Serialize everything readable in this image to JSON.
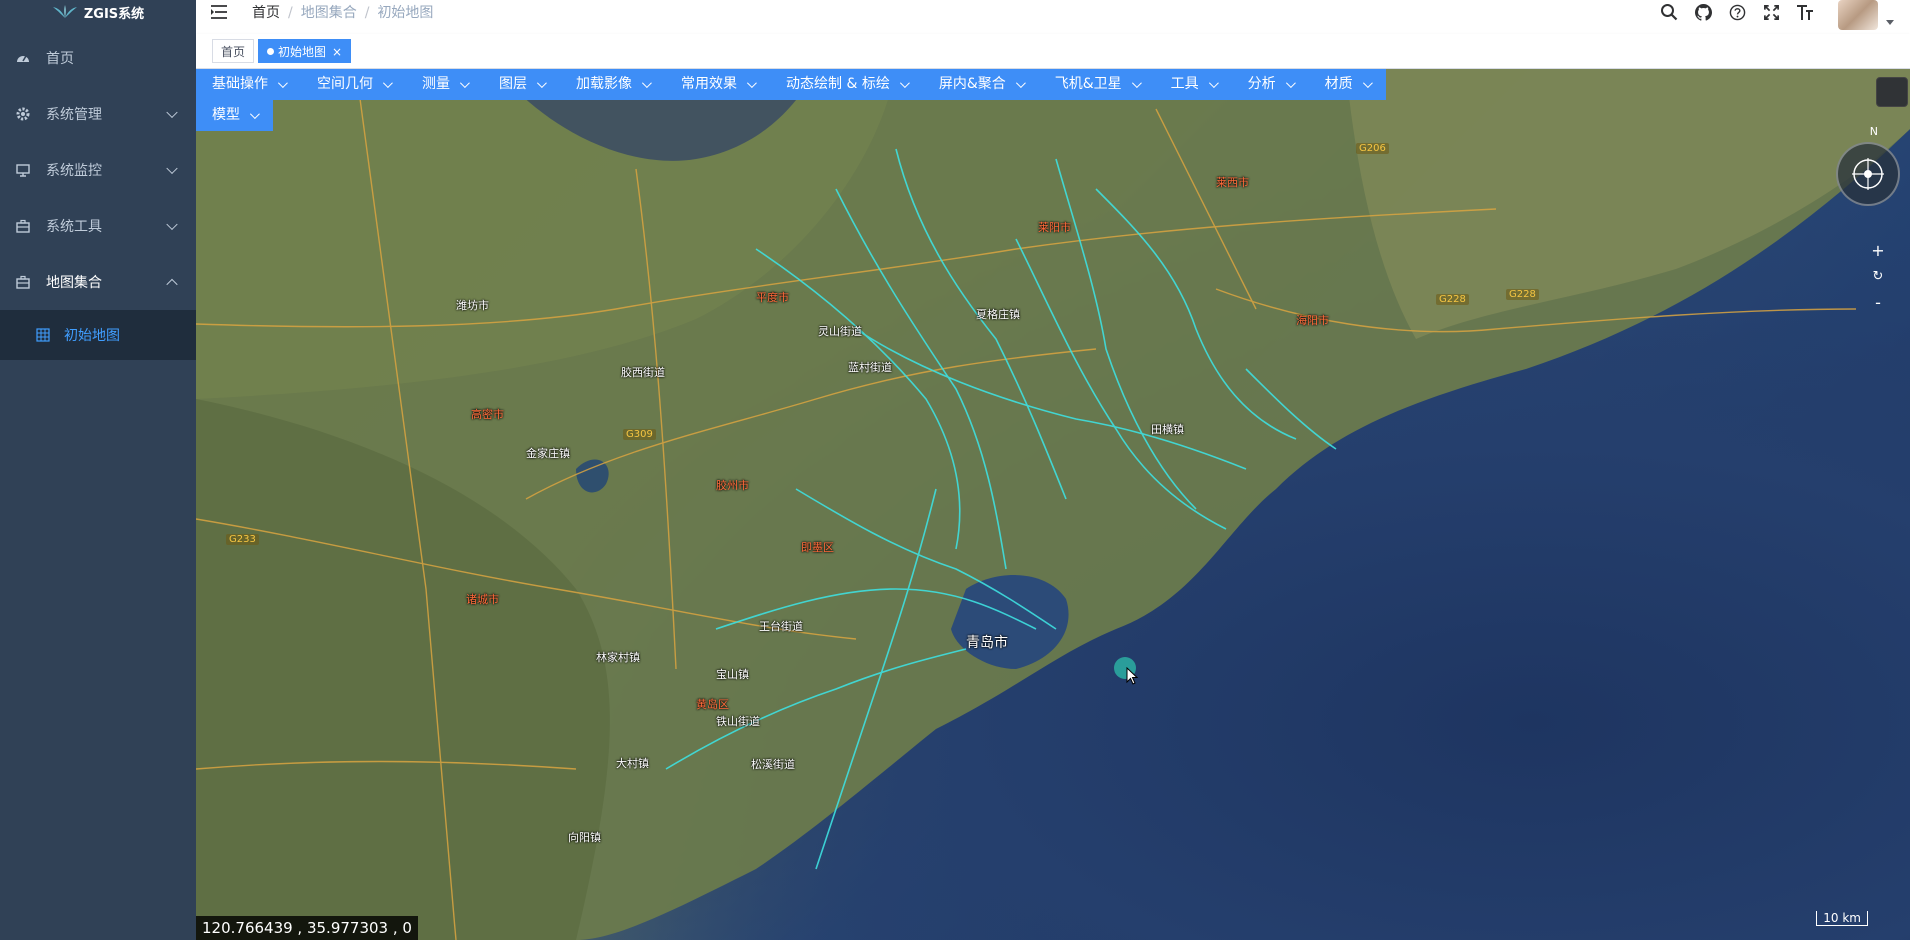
{
  "app": {
    "logo_text": "ZGIS系统"
  },
  "sidebar": {
    "items": [
      {
        "label": "首页",
        "icon": "dashboard-icon"
      },
      {
        "label": "系统管理",
        "icon": "gear-icon"
      },
      {
        "label": "系统监控",
        "icon": "monitor-icon"
      },
      {
        "label": "系统工具",
        "icon": "toolbox-icon"
      },
      {
        "label": "地图集合",
        "icon": "toolbox-icon"
      }
    ],
    "submenu": [
      {
        "label": "初始地图",
        "icon": "grid-icon"
      }
    ]
  },
  "navbar": {
    "breadcrumb": [
      "首页",
      "地图集合",
      "初始地图"
    ],
    "icons": [
      "search-icon",
      "github-icon",
      "help-icon",
      "fullscreen-icon",
      "font-size-icon"
    ]
  },
  "tags": [
    {
      "label": "首页"
    },
    {
      "label": "初始地图",
      "active": true
    }
  ],
  "toolbar": [
    "基础操作",
    "空间几何",
    "测量",
    "图层",
    "加载影像",
    "常用效果",
    "动态绘制 & 标绘",
    "屏内&聚合",
    "飞机&卫星",
    "工具",
    "分析",
    "材质",
    "模型"
  ],
  "map": {
    "compass_n": "N",
    "zoom_in": "+",
    "reset": "↻",
    "zoom_out": "-",
    "coords": "120.766439 ,  35.977303 ,  0",
    "scale": "10 km",
    "labels": {
      "qingdao": "青岛市",
      "jiaozhou": "胶州市",
      "weifang": "潍坊市",
      "gaomi": "高密市",
      "zhucheng": "诸城市",
      "jimo": "即墨区",
      "laixi": "莱西市",
      "pingdu": "平度市",
      "huangdao": "黄岛区",
      "laiyang": "莱阳市",
      "haiyang": "海阳市",
      "tianheng": "田横镇",
      "wangtai": "王台街道",
      "lingshan": "灵山街道",
      "xiagezhuang": "夏格庄镇",
      "lanya": "蓝村街道",
      "jiaoxi": "胶西街道",
      "baoshan": "宝山镇",
      "tieshan": "铁山街道",
      "dacun": "大村镇",
      "xiangzhuang": "向阳镇",
      "jinjiazhuang": "金家庄镇",
      "songxi": "松溪街道",
      "lindong": "林家村镇"
    },
    "shields": [
      "G206",
      "G228",
      "G309",
      "G233",
      "G228"
    ]
  }
}
